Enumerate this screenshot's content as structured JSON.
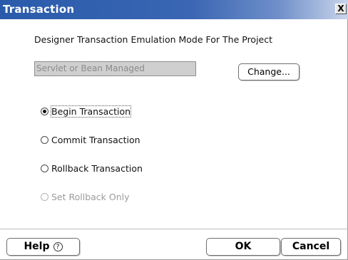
{
  "window": {
    "title": "Transaction",
    "close_glyph": "X"
  },
  "main": {
    "heading": "Designer Transaction Emulation Mode For The Project",
    "mode_value": "Servlet or Bean Managed",
    "change_label": "Change..."
  },
  "options": [
    {
      "label": "Begin Transaction",
      "checked": true,
      "enabled": true
    },
    {
      "label": "Commit Transaction",
      "checked": false,
      "enabled": true
    },
    {
      "label": "Rollback Transaction",
      "checked": false,
      "enabled": true
    },
    {
      "label": "Set Rollback Only",
      "checked": false,
      "enabled": false
    }
  ],
  "footer": {
    "help_label": "Help",
    "help_icon": "question-circle-icon",
    "ok_label": "OK",
    "cancel_label": "Cancel"
  },
  "colors": {
    "titlebar": "#2a5bab",
    "disabled_text": "#9b9b9b"
  }
}
